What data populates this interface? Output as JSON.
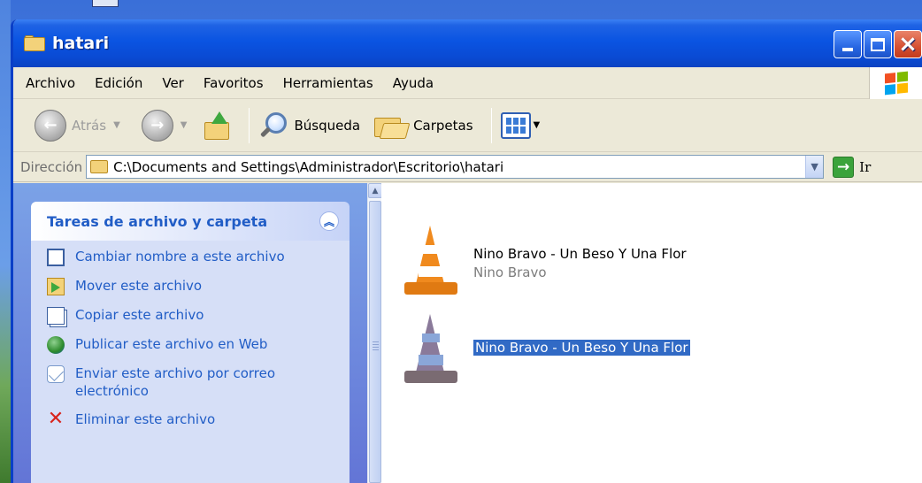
{
  "window": {
    "title": "hatari"
  },
  "menu": {
    "items": [
      "Archivo",
      "Edición",
      "Ver",
      "Favoritos",
      "Herramientas",
      "Ayuda"
    ]
  },
  "toolbar": {
    "back_label": "Atrás",
    "search_label": "Búsqueda",
    "folders_label": "Carpetas"
  },
  "address": {
    "label": "Dirección",
    "path": "C:\\Documents and Settings\\Administrador\\Escritorio\\hatari",
    "go_label": "Ir"
  },
  "taskpane": {
    "header": "Tareas de archivo y carpeta",
    "tasks": [
      {
        "icon": "rename-icon",
        "label": "Cambiar nombre a este archivo"
      },
      {
        "icon": "move-icon",
        "label": "Mover este archivo"
      },
      {
        "icon": "copy-icon",
        "label": "Copiar este archivo"
      },
      {
        "icon": "publish-web-icon",
        "label": "Publicar este archivo en Web"
      },
      {
        "icon": "email-icon",
        "label": "Enviar este archivo por correo electrónico"
      },
      {
        "icon": "delete-icon",
        "label": "Eliminar este archivo"
      }
    ]
  },
  "files": [
    {
      "name": "Nino Bravo - Un Beso Y Una Flor",
      "subtitle": "Nino Bravo",
      "icon": "vlc-cone-icon",
      "selected": false
    },
    {
      "name": "Nino Bravo - Un Beso Y Una Flor",
      "subtitle": "",
      "icon": "vlc-cone-icon",
      "selected": true
    }
  ],
  "colors": {
    "titlebar": "#0a54e2",
    "taskpane_link": "#215dc6",
    "selection": "#316ac5"
  }
}
